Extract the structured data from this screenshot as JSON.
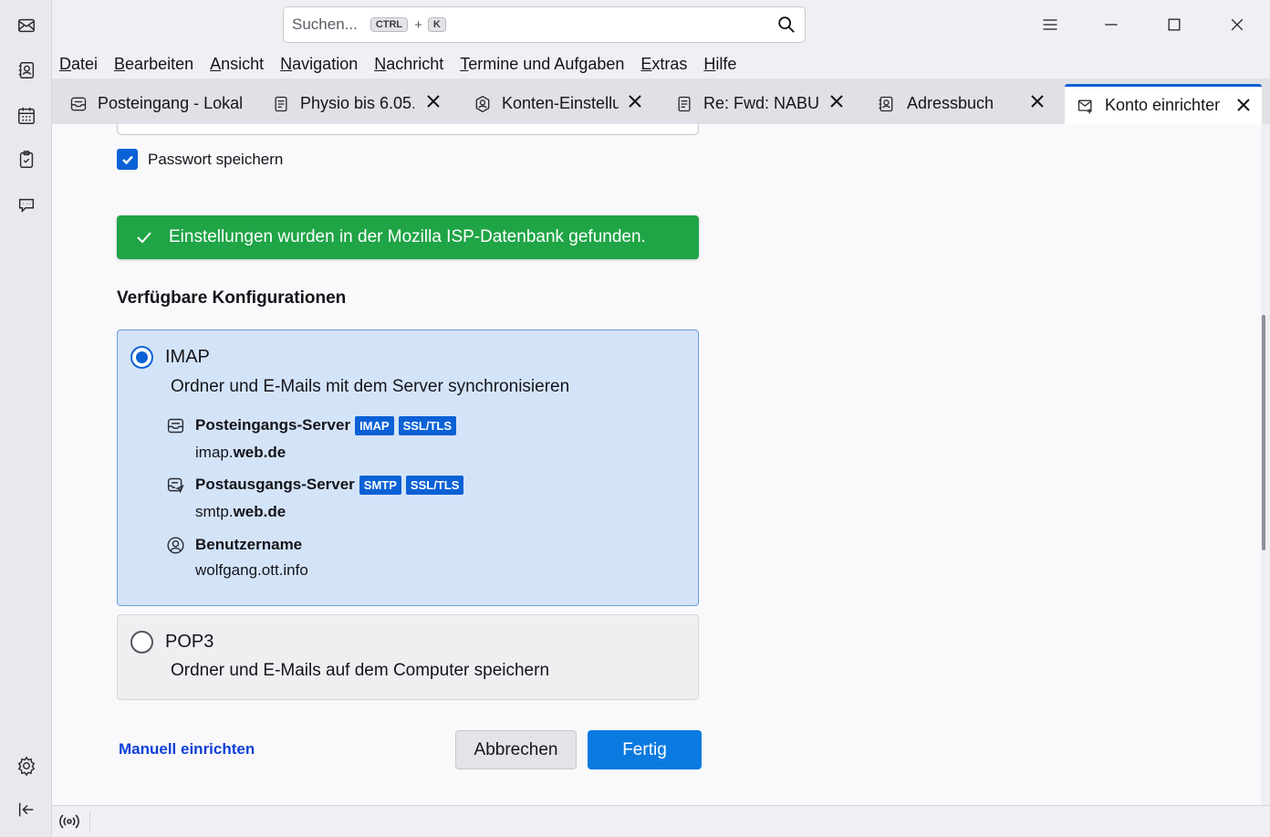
{
  "search": {
    "placeholder": "Suchen...",
    "shortcut_ctrl": "CTRL",
    "shortcut_plus": "+",
    "shortcut_key": "K"
  },
  "menu": [
    "Datei",
    "Bearbeiten",
    "Ansicht",
    "Navigation",
    "Nachricht",
    "Termine und Aufgaben",
    "Extras",
    "Hilfe"
  ],
  "tabs": [
    {
      "label": "Posteingang - Lokal",
      "icon": "inbox-icon"
    },
    {
      "label": "Physio bis 6.05.",
      "icon": "document-icon"
    },
    {
      "label": "Konten-Einstellu",
      "icon": "account-settings-icon"
    },
    {
      "label": "Re: Fwd: NABU |",
      "icon": "document-icon"
    },
    {
      "label": "Adressbuch",
      "icon": "address-book-icon"
    },
    {
      "label": "Konto einrichten",
      "icon": "mail-add-icon"
    }
  ],
  "form": {
    "save_password": "Passwort speichern",
    "success_message": "Einstellungen wurden in der Mozilla ISP-Datenbank gefunden.",
    "section_title": "Verfügbare Konfigurationen"
  },
  "imap": {
    "name": "IMAP",
    "description": "Ordner und E-Mails mit dem Server synchronisieren",
    "incoming_title": "Posteingangs-Server",
    "incoming_badges": [
      "IMAP",
      "SSL/TLS"
    ],
    "incoming_prefix": "imap.",
    "incoming_domain": "web.de",
    "outgoing_title": "Postausgangs-Server",
    "outgoing_badges": [
      "SMTP",
      "SSL/TLS"
    ],
    "outgoing_prefix": "smtp.",
    "outgoing_domain": "web.de",
    "username_title": "Benutzername",
    "username": "wolfgang.ott.info"
  },
  "pop3": {
    "name": "POP3",
    "description": "Ordner und E-Mails auf dem Computer speichern"
  },
  "actions": {
    "manual": "Manuell einrichten",
    "cancel": "Abbrechen",
    "done": "Fertig"
  },
  "colors": {
    "accent": "#0b61d6",
    "success": "#1fa446",
    "imap_bg": "#d4e4f8"
  }
}
